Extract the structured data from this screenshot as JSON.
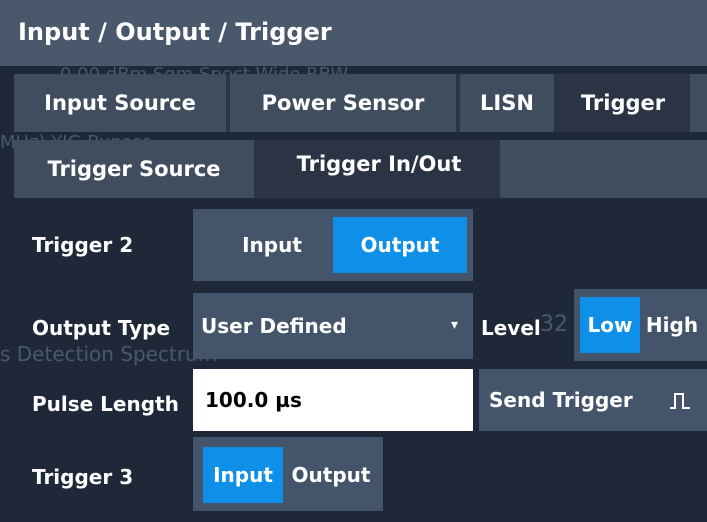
{
  "dialog": {
    "title": "Input / Output / Trigger"
  },
  "background": {
    "row1": "0.00 dBm      Sgm Spect                    Wide    RBW",
    "row2": "MHz) YIG Bypass",
    "row3": "s Detection Spectrum",
    "frag": "32"
  },
  "tabs": [
    {
      "label": "Input Source",
      "active": false
    },
    {
      "label": "Power Sensor",
      "active": false
    },
    {
      "label": "LISN",
      "active": false
    },
    {
      "label": "Trigger",
      "active": true
    }
  ],
  "subtabs": [
    {
      "label": "Trigger Source",
      "active": false
    },
    {
      "label": "Trigger In/Out",
      "active": true
    }
  ],
  "trigger2": {
    "label": "Trigger 2",
    "options": [
      "Input",
      "Output"
    ],
    "selected": "Output"
  },
  "output_type": {
    "label": "Output Type",
    "value": "User Defined"
  },
  "level": {
    "label": "Level",
    "options": [
      "Low",
      "High"
    ],
    "selected": "Low"
  },
  "pulse_length": {
    "label": "Pulse Length",
    "value": "100.0 µs"
  },
  "send_trigger": {
    "label": "Send Trigger",
    "icon": "pulse-icon"
  },
  "trigger3": {
    "label": "Trigger 3",
    "options": [
      "Input",
      "Output"
    ],
    "selected": "Input"
  },
  "colors": {
    "accent": "#0e8fe8",
    "titlebar": "#49586a",
    "tab": "#3f4d5f",
    "background": "#1d2635"
  }
}
